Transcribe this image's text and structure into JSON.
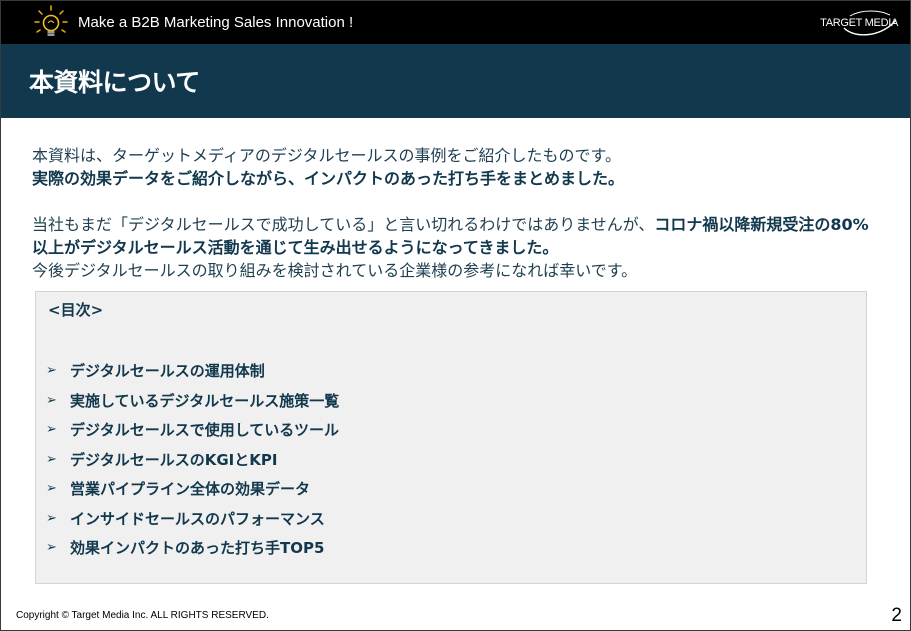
{
  "header": {
    "tagline": "Make a B2B Marketing Sales Innovation !",
    "logo_text": "TARGET MEDIA",
    "bulb_icon": "lightbulb-icon"
  },
  "slide": {
    "title": "本資料について"
  },
  "intro": {
    "line1": "本資料は、ターゲットメディアのデジタルセールスの事例をご紹介したものです。",
    "line2": "実際の効果データをご紹介しながら、インパクトのあった打ち手をまとめました。",
    "line3_normal": "当社もまだ「デジタルセールスで成功している」と言い切れるわけではありませんが、",
    "line3_bold": "コロナ禍以降新規受注の80%以上がデジタルセールス活動を通じて生み出せるようになってきました。",
    "line4": "今後デジタルセールスの取り組みを検討されている企業様の参考になれば幸いです。"
  },
  "toc": {
    "heading": "<目次>",
    "bullet_glyph": "➢",
    "items": [
      "デジタルセールスの運用体制",
      "実施しているデジタルセールス施策一覧",
      "デジタルセールスで使用しているツール",
      "デジタルセールスのKGIとKPI",
      "営業パイプライン全体の効果データ",
      "インサイドセールスのパフォーマンス",
      "効果インパクトのあった打ち手TOP5"
    ]
  },
  "footer": {
    "copyright": "Copyright © Target Media Inc. ALL RIGHTS RESERVED.",
    "page_number": "2"
  },
  "colors": {
    "topbar": "#000000",
    "titlebar": "#12384d",
    "text": "#1f3f52",
    "toc_background": "#f0f0f0"
  }
}
